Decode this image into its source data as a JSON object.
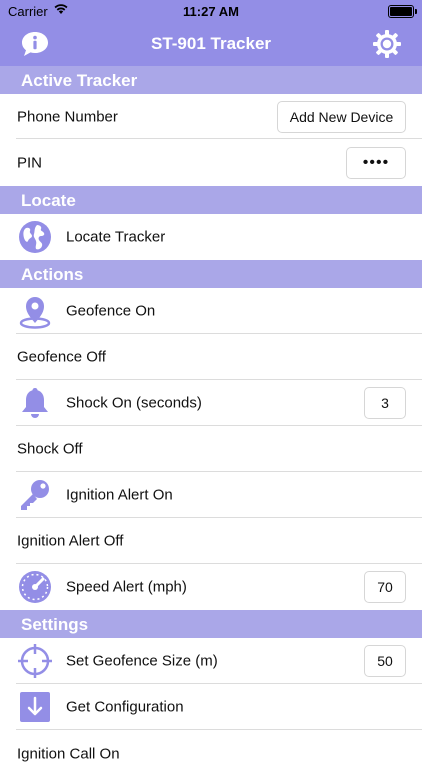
{
  "status_bar": {
    "carrier": "Carrier",
    "time": "11:27 AM"
  },
  "nav": {
    "title": "ST-901 Tracker",
    "info_icon": "info-icon",
    "settings_icon": "gear-icon"
  },
  "colors": {
    "accent": "#938ee6",
    "section_bg": "#aaa7e8"
  },
  "sections": {
    "active_tracker": "Active Tracker",
    "locate": "Locate",
    "actions": "Actions",
    "settings": "Settings"
  },
  "active_tracker": {
    "phone_label": "Phone Number",
    "phone_button": "Add New Device",
    "pin_label": "PIN",
    "pin_value": "••••"
  },
  "locate": {
    "label": "Locate Tracker",
    "icon": "globe-icon"
  },
  "actions": {
    "geofence_on": "Geofence On",
    "geofence_off": "Geofence Off",
    "shock_on": "Shock On (seconds)",
    "shock_on_value": "3",
    "shock_off": "Shock Off",
    "ignition_on": "Ignition Alert On",
    "ignition_off": "Ignition Alert Off",
    "speed_alert": "Speed Alert (mph)",
    "speed_alert_value": "70"
  },
  "settings": {
    "geofence_size": "Set Geofence Size (m)",
    "geofence_size_value": "50",
    "get_config": "Get Configuration",
    "ignition_call_on": "Ignition Call On"
  }
}
